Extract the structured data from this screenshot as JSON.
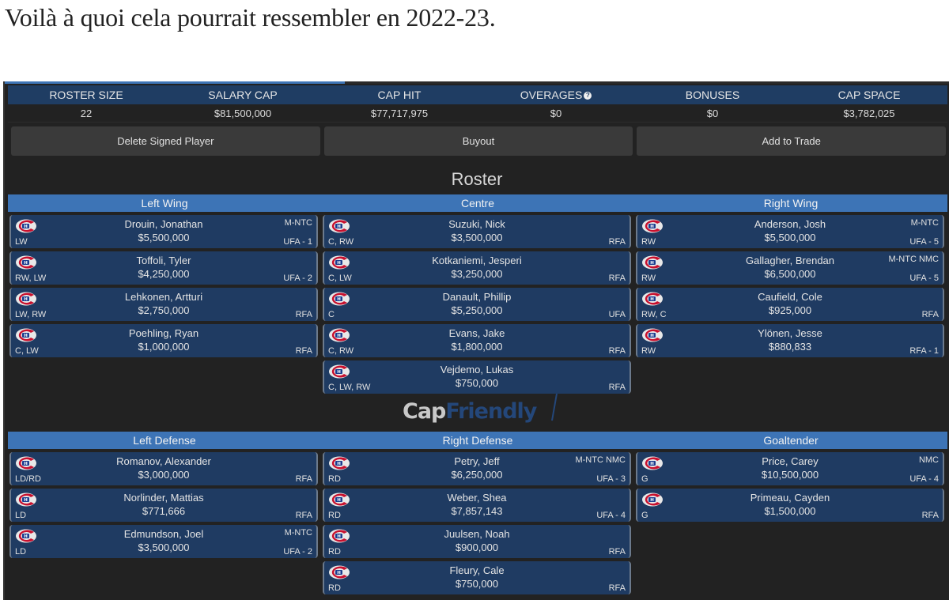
{
  "headline": "Voilà à quoi cela pourrait ressembler en 2022-23.",
  "stats": {
    "headers": [
      "ROSTER SIZE",
      "SALARY CAP",
      "CAP HIT",
      "OVERAGES",
      "BONUSES",
      "CAP SPACE"
    ],
    "values": [
      "22",
      "$81,500,000",
      "$77,717,975",
      "$0",
      "$0",
      "$3,782,025"
    ],
    "overages_help_icon": "question-circle-icon"
  },
  "buttons": {
    "delete": "Delete Signed Player",
    "buyout": "Buyout",
    "trade": "Add to Trade"
  },
  "roster_title": "Roster",
  "forwards_sections": [
    "Left Wing",
    "Centre",
    "Right Wing"
  ],
  "defense_sections": [
    "Left Defense",
    "Right Defense",
    "Goaltender"
  ],
  "logo": {
    "cap": "Cap",
    "friendly": "Friendly"
  },
  "colors": {
    "stats_header_bg": "#1f3d63",
    "section_header_bg": "#3d74b6",
    "card_bg": "#1f3b62",
    "app_bg": "#222222",
    "button_bg": "#3a3a3a",
    "team_red": "#c8102e",
    "team_blue": "#1b3d8f"
  },
  "left_wing": [
    {
      "name": "Drouin, Jonathan",
      "cap": "$5,500,000",
      "pos": "LW",
      "clause": "M-NTC",
      "status": "UFA - 1"
    },
    {
      "name": "Toffoli, Tyler",
      "cap": "$4,250,000",
      "pos": "RW, LW",
      "clause": "",
      "status": "UFA - 2"
    },
    {
      "name": "Lehkonen, Artturi",
      "cap": "$2,750,000",
      "pos": "LW, RW",
      "clause": "",
      "status": "RFA"
    },
    {
      "name": "Poehling, Ryan",
      "cap": "$1,000,000",
      "pos": "C, LW",
      "clause": "",
      "status": "RFA"
    }
  ],
  "centre": [
    {
      "name": "Suzuki, Nick",
      "cap": "$3,500,000",
      "pos": "C, RW",
      "clause": "",
      "status": "RFA"
    },
    {
      "name": "Kotkaniemi, Jesperi",
      "cap": "$3,250,000",
      "pos": "C, LW",
      "clause": "",
      "status": "RFA"
    },
    {
      "name": "Danault, Phillip",
      "cap": "$5,250,000",
      "pos": "C",
      "clause": "",
      "status": "UFA"
    },
    {
      "name": "Evans, Jake",
      "cap": "$1,800,000",
      "pos": "C, RW",
      "clause": "",
      "status": "RFA"
    },
    {
      "name": "Vejdemo, Lukas",
      "cap": "$750,000",
      "pos": "C, LW, RW",
      "clause": "",
      "status": "RFA"
    }
  ],
  "right_wing": [
    {
      "name": "Anderson, Josh",
      "cap": "$5,500,000",
      "pos": "RW",
      "clause": "M-NTC",
      "status": "UFA - 5"
    },
    {
      "name": "Gallagher, Brendan",
      "cap": "$6,500,000",
      "pos": "RW",
      "clause": "M-NTC NMC",
      "status": "UFA - 5"
    },
    {
      "name": "Caufield, Cole",
      "cap": "$925,000",
      "pos": "RW, C",
      "clause": "",
      "status": "RFA"
    },
    {
      "name": "Ylönen, Jesse",
      "cap": "$880,833",
      "pos": "RW",
      "clause": "",
      "status": "RFA - 1"
    }
  ],
  "left_defense": [
    {
      "name": "Romanov, Alexander",
      "cap": "$3,000,000",
      "pos": "LD/RD",
      "clause": "",
      "status": "RFA"
    },
    {
      "name": "Norlinder, Mattias",
      "cap": "$771,666",
      "pos": "LD",
      "clause": "",
      "status": "RFA"
    },
    {
      "name": "Edmundson, Joel",
      "cap": "$3,500,000",
      "pos": "LD",
      "clause": "M-NTC",
      "status": "UFA - 2"
    }
  ],
  "right_defense": [
    {
      "name": "Petry, Jeff",
      "cap": "$6,250,000",
      "pos": "RD",
      "clause": "M-NTC NMC",
      "status": "UFA - 3"
    },
    {
      "name": "Weber, Shea",
      "cap": "$7,857,143",
      "pos": "RD",
      "clause": "",
      "status": "UFA - 4"
    },
    {
      "name": "Juulsen, Noah",
      "cap": "$900,000",
      "pos": "RD",
      "clause": "",
      "status": "RFA"
    },
    {
      "name": "Fleury, Cale",
      "cap": "$750,000",
      "pos": "RD",
      "clause": "",
      "status": "RFA"
    }
  ],
  "goaltender": [
    {
      "name": "Price, Carey",
      "cap": "$10,500,000",
      "pos": "G",
      "clause": "NMC",
      "status": "UFA - 4"
    },
    {
      "name": "Primeau, Cayden",
      "cap": "$1,500,000",
      "pos": "G",
      "clause": "",
      "status": "RFA"
    }
  ]
}
